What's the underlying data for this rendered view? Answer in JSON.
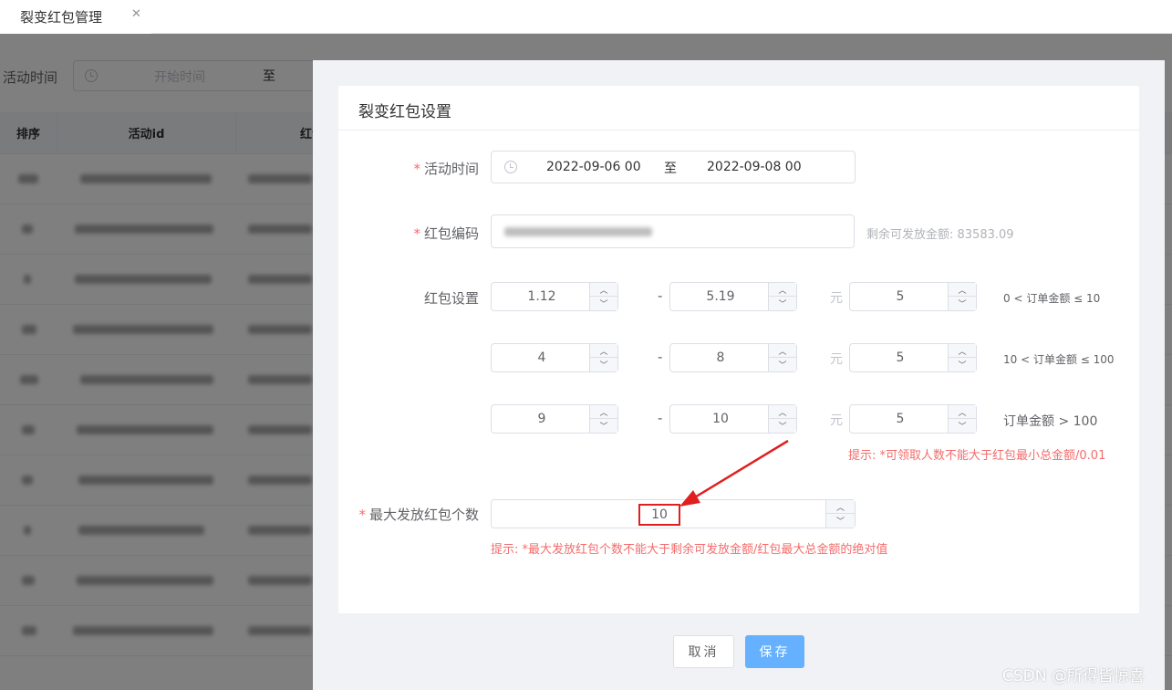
{
  "tabs": [
    {
      "label": "裂变红包管理",
      "close": "✕"
    }
  ],
  "filter": {
    "label": "活动时间",
    "start_placeholder": "开始时间",
    "separator": "至"
  },
  "table": {
    "headers": [
      "排序",
      "活动id",
      "红包"
    ],
    "row_count": 10
  },
  "dialog": {
    "title": "裂变红包设置",
    "activity_time": {
      "label": "活动时间",
      "start": "2022-09-06 00",
      "separator": "至",
      "end": "2022-09-08 00"
    },
    "red_packet_code": {
      "label": "红包编码",
      "remaining_label": "剩余可发放金额: 83583.09"
    },
    "red_packet_settings": {
      "label": "红包设置",
      "unit": "元",
      "dash": "-",
      "rows": [
        {
          "min": "1.12",
          "max": "5.19",
          "count": "5",
          "condition": "0 < 订单金额 ≤ 10"
        },
        {
          "min": "4",
          "max": "8",
          "count": "5",
          "condition": "10 < 订单金额 ≤ 100"
        },
        {
          "min": "9",
          "max": "10",
          "count": "5",
          "condition": "订单金额 > 100"
        }
      ],
      "hint": "提示: *可领取人数不能大于红包最小总金额/0.01"
    },
    "max_count": {
      "label": "最大发放红包个数",
      "value": "10",
      "hint": "提示: *最大发放红包个数不能大于剩余可发放金额/红包最大总金额的绝对值"
    },
    "cancel_label": "取消",
    "save_label": "保存"
  },
  "colors": {
    "primary_button": "#66b1ff",
    "required_mark": "#f56c6c",
    "highlight_box": "#e02020"
  },
  "icons": {
    "tab_close": "close-icon",
    "date_picker": "clock-icon",
    "spinner_up": "chevron-up-icon",
    "spinner_down": "chevron-down-icon",
    "annotation_arrow": "arrow-icon"
  },
  "watermark": "CSDN @所得皆惊喜"
}
